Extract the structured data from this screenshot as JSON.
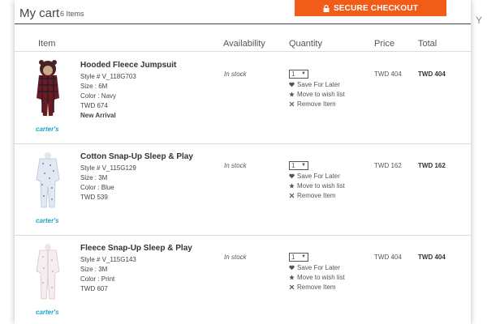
{
  "header": {
    "title": "My cart",
    "item_count": "6 Items",
    "checkout_label": "SECURE CHECKOUT"
  },
  "stray_text": "Y",
  "columns": {
    "item": "Item",
    "availability": "Availability",
    "quantity": "Quantity",
    "price": "Price",
    "total": "Total"
  },
  "accent_color": "#f25c19",
  "items": [
    {
      "name": "Hooded Fleece Jumpsuit",
      "style": "Style # V_118G703",
      "size": "Size : 6M",
      "color": "Color : Navy",
      "original_price": "TWD 674",
      "badge": "New Arrival",
      "brand": "carter's",
      "availability": "In stock",
      "quantity": "1",
      "actions": {
        "save": "Save For Later",
        "wish": "Move to wish list",
        "remove": "Remove Item"
      },
      "price": "TWD 404",
      "total": "TWD 404"
    },
    {
      "name": "Cotton Snap-Up Sleep & Play",
      "style": "Style # V_115G129",
      "size": "Size : 3M",
      "color": "Color : Blue",
      "original_price": "TWD 539",
      "badge": "",
      "brand": "carter's",
      "availability": "In stock",
      "quantity": "1",
      "actions": {
        "save": "Save For Later",
        "wish": "Move to wish list",
        "remove": "Remove Item"
      },
      "price": "TWD 162",
      "total": "TWD 162"
    },
    {
      "name": "Fleece Snap-Up Sleep & Play",
      "style": "Style # V_115G143",
      "size": "Size : 3M",
      "color": "Color : Print",
      "original_price": "TWD 607",
      "badge": "",
      "brand": "carter's",
      "availability": "In stock",
      "quantity": "1",
      "actions": {
        "save": "Save For Later",
        "wish": "Move to wish list",
        "remove": "Remove Item"
      },
      "price": "TWD 404",
      "total": "TWD 404"
    }
  ]
}
